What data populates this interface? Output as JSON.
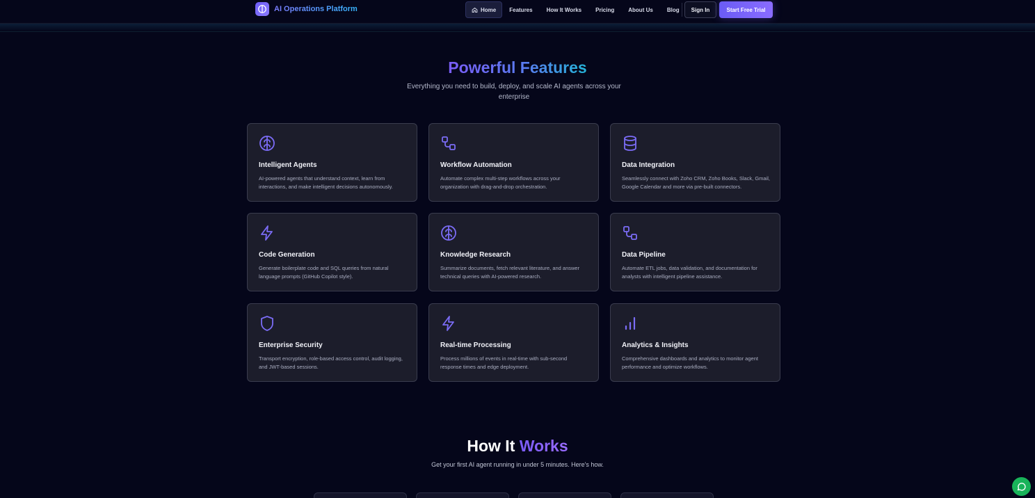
{
  "brand": {
    "name": "AI Operations Platform"
  },
  "nav": {
    "links": [
      {
        "label": "Home",
        "active": true
      },
      {
        "label": "Features"
      },
      {
        "label": "How It Works"
      },
      {
        "label": "Pricing"
      },
      {
        "label": "About Us"
      },
      {
        "label": "Blog"
      }
    ],
    "sign_in": "Sign In",
    "start_trial": "Start Free Trial"
  },
  "features": {
    "title": "Powerful Features",
    "subtitle": "Everything you need to build, deploy, and scale AI agents across your enterprise",
    "cards": [
      {
        "icon": "brain-icon",
        "title": "Intelligent Agents",
        "desc": "AI-powered agents that understand context, learn from interactions, and make intelligent decisions autonomously."
      },
      {
        "icon": "workflow-icon",
        "title": "Workflow Automation",
        "desc": "Automate complex multi-step workflows across your organization with drag-and-drop orchestration."
      },
      {
        "icon": "database-icon",
        "title": "Data Integration",
        "desc": "Seamlessly connect with Zoho CRM, Zoho Books, Slack, Gmail, Google Calendar and more via pre-built connectors."
      },
      {
        "icon": "lightning-icon",
        "title": "Code Generation",
        "desc": "Generate boilerplate code and SQL queries from natural language prompts (GitHub Copilot style)."
      },
      {
        "icon": "brain-icon",
        "title": "Knowledge Research",
        "desc": "Summarize documents, fetch relevant literature, and answer technical queries with AI-powered research."
      },
      {
        "icon": "workflow-icon",
        "title": "Data Pipeline",
        "desc": "Automate ETL jobs, data validation, and documentation for analysts with intelligent pipeline assistance."
      },
      {
        "icon": "shield-icon",
        "title": "Enterprise Security",
        "desc": "Transport encryption, role-based access control, audit logging, and JWT-based sessions."
      },
      {
        "icon": "lightning-icon",
        "title": "Real-time Processing",
        "desc": "Process millions of events in real-time with sub-second response times and edge deployment."
      },
      {
        "icon": "bar-chart-icon",
        "title": "Analytics & Insights",
        "desc": "Comprehensive dashboards and analytics to monitor agent performance and optimize workflows."
      }
    ]
  },
  "how_it_works": {
    "title_part1": "How It",
    "title_part2": "Works",
    "subtitle": "Get your first AI agent running in under 5 minutes. Here's how."
  },
  "colors": {
    "accent": "#6a5cf5",
    "icon": "#7b6cf6",
    "chat": "#19b35a"
  }
}
